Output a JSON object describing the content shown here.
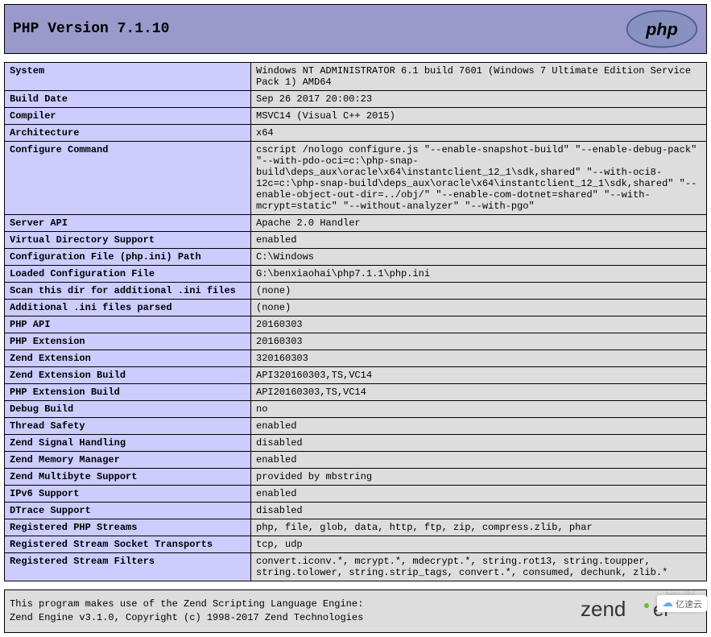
{
  "header": {
    "title": "PHP Version 7.1.10"
  },
  "rows": [
    {
      "label": "System",
      "value": "Windows NT ADMINISTRATOR 6.1 build 7601 (Windows 7 Ultimate Edition Service Pack 1) AMD64"
    },
    {
      "label": "Build Date",
      "value": "Sep 26 2017 20:00:23"
    },
    {
      "label": "Compiler",
      "value": "MSVC14 (Visual C++ 2015)"
    },
    {
      "label": "Architecture",
      "value": "x64"
    },
    {
      "label": "Configure Command",
      "value": "cscript /nologo configure.js \"--enable-snapshot-build\" \"--enable-debug-pack\" \"--with-pdo-oci=c:\\php-snap-build\\deps_aux\\oracle\\x64\\instantclient_12_1\\sdk,shared\" \"--with-oci8-12c=c:\\php-snap-build\\deps_aux\\oracle\\x64\\instantclient_12_1\\sdk,shared\" \"--enable-object-out-dir=../obj/\" \"--enable-com-dotnet=shared\" \"--with-mcrypt=static\" \"--without-analyzer\" \"--with-pgo\""
    },
    {
      "label": "Server API",
      "value": "Apache 2.0 Handler"
    },
    {
      "label": "Virtual Directory Support",
      "value": "enabled"
    },
    {
      "label": "Configuration File (php.ini) Path",
      "value": "C:\\Windows"
    },
    {
      "label": "Loaded Configuration File",
      "value": "G:\\benxiaohai\\php7.1.1\\php.ini"
    },
    {
      "label": "Scan this dir for additional .ini files",
      "value": " (none)"
    },
    {
      "label": "Additional .ini files parsed",
      "value": " (none)"
    },
    {
      "label": "PHP API",
      "value": "20160303"
    },
    {
      "label": "PHP Extension",
      "value": "20160303"
    },
    {
      "label": "Zend Extension",
      "value": "320160303"
    },
    {
      "label": "Zend Extension Build",
      "value": "API320160303,TS,VC14"
    },
    {
      "label": "PHP Extension Build",
      "value": "API20160303,TS,VC14"
    },
    {
      "label": "Debug Build",
      "value": "no"
    },
    {
      "label": "Thread Safety",
      "value": "enabled"
    },
    {
      "label": "Zend Signal Handling",
      "value": "disabled"
    },
    {
      "label": "Zend Memory Manager",
      "value": "enabled"
    },
    {
      "label": "Zend Multibyte Support",
      "value": "provided by mbstring"
    },
    {
      "label": "IPv6 Support",
      "value": "enabled"
    },
    {
      "label": "DTrace Support",
      "value": "disabled"
    },
    {
      "label": "Registered PHP Streams",
      "value": "php, file, glob, data, http, ftp, zip, compress.zlib, phar"
    },
    {
      "label": "Registered Stream Socket Transports",
      "value": "tcp, udp"
    },
    {
      "label": "Registered Stream Filters",
      "value": "convert.iconv.*, mcrypt.*, mdecrypt.*, string.rot13, string.toupper, string.tolower, string.strip_tags, convert.*, consumed, dechunk, zlib.*"
    }
  ],
  "footer": {
    "line1": "This program makes use of the Zend Scripting Language Engine:",
    "line2": "Zend Engine v3.1.0, Copyright (c) 1998-2017 Zend Technologies"
  },
  "watermark": "http://bl",
  "badge": "亿速云"
}
